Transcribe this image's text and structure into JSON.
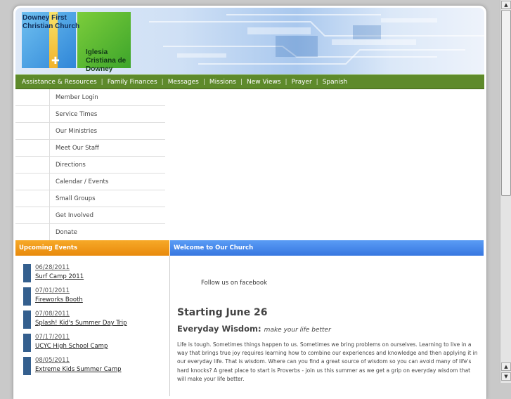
{
  "banner": {
    "logo_text_en": "Downey First Christian Church",
    "logo_text_es": "Iglesia Cristiana de Downey"
  },
  "nav": {
    "items": [
      "Assistance & Resources",
      "Family Finances",
      "Messages",
      "Missions",
      "New Views",
      "Prayer",
      "Spanish"
    ]
  },
  "sidemenu": {
    "items": [
      "Member Login",
      "Service Times",
      "Our Ministries",
      "Meet Our Staff",
      "Directions",
      "Calendar / Events",
      "Small Groups",
      "Get Involved",
      "Donate"
    ]
  },
  "events_panel": {
    "title": "Upcoming Events",
    "events": [
      {
        "date": "06/28/2011",
        "title": "Surf Camp 2011"
      },
      {
        "date": "07/01/2011",
        "title": "Fireworks Booth"
      },
      {
        "date": "07/08/2011",
        "title": "Splash! Kid's Summer Day Trip"
      },
      {
        "date": "07/17/2011",
        "title": "UCYC High School Camp"
      },
      {
        "date": "08/05/2011",
        "title": "Extreme Kids Summer Camp"
      }
    ]
  },
  "welcome_panel": {
    "title": "Welcome to Our Church",
    "follow": "Follow us on facebook",
    "heading": "Starting June 26",
    "subheading": "Everyday Wisdom:",
    "subheading_tag": "make your life better",
    "body": "Life is tough.  Sometimes things happen to us.  Sometimes we bring problems on ourselves.  Learning to live in a way that brings true joy requires learning how to combine our experiences and knowledge and then applying it in our everyday life.  That is wisdom.  Where can you find a great source of wisdom so you can avoid many of life's hard knocks?  A great place to start is Proverbs - join us this summer as we get a grip on everyday wisdom that will make your life better."
  },
  "colors": {
    "nav_green": "#5e8a2b",
    "events_orange": "#f39b1a",
    "welcome_blue": "#4a8bef",
    "event_bar": "#345f8e"
  }
}
